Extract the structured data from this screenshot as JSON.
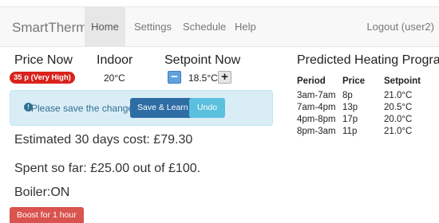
{
  "navbar": {
    "brand": "SmartThermo",
    "items": [
      "Home",
      "Settings",
      "Schedule",
      "Help"
    ],
    "logout": "Logout (user2)"
  },
  "status": {
    "price_heading": "Price Now",
    "price_badge": "35 p (Very High)",
    "indoor_heading": "Indoor",
    "indoor_value": "20°C",
    "setpoint_heading": "Setpoint Now",
    "setpoint_value": "18.5°C",
    "minus_label": "−",
    "plus_label": "+"
  },
  "alert": {
    "icon": "info-icon",
    "icon_glyph": "!",
    "message": "Please save the changes.",
    "save_label": "Save & Learn",
    "undo_label": "Undo",
    "color": "#d9edf7"
  },
  "summary": {
    "cost": "Estimated 30 days cost: £79.30",
    "spent": "Spent so far: £25.00 out of £100.",
    "boiler": "Boiler:ON",
    "boost_label": "Boost for 1 hour"
  },
  "program": {
    "title": "Predicted Heating Program",
    "columns": [
      "Period",
      "Price",
      "Setpoint"
    ],
    "rows": [
      {
        "period": "3am-7am",
        "price": "8p",
        "setpoint": "21.0°C"
      },
      {
        "period": "7am-4pm",
        "price": "13p",
        "setpoint": "20.5°C"
      },
      {
        "period": "4pm-8pm",
        "price": "17p",
        "setpoint": "20.0°C"
      },
      {
        "period": "8pm-3am",
        "price": "11p",
        "setpoint": "21.0°C"
      }
    ]
  },
  "colors": {
    "price_badge": "#d9221c",
    "save_button": "#2e6da4",
    "undo_button": "#5bc0de",
    "boost_button": "#d9534f"
  }
}
